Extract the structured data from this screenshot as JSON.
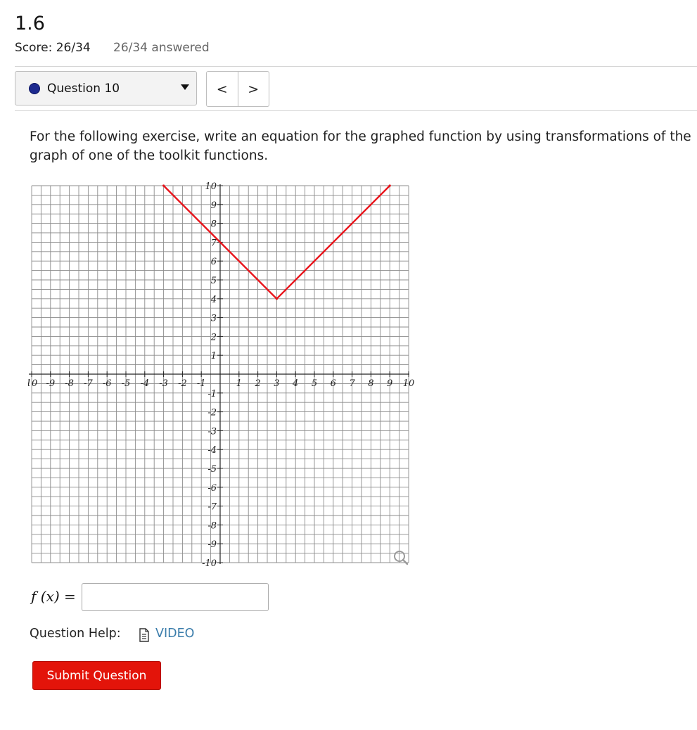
{
  "header": {
    "title": "1.6",
    "score": "Score: 26/34",
    "answered": "26/34 answered"
  },
  "question_nav": {
    "current": "Question 10",
    "prev": "<",
    "next": ">",
    "status_color": "#1d2a8f"
  },
  "prompt": "For the following exercise, write an equation for the graphed function by using transformations of the graph of one of the toolkit functions.",
  "chart_data": {
    "type": "line",
    "xlim": [
      -10,
      10
    ],
    "ylim": [
      -10,
      10
    ],
    "grid": true,
    "grid_step": 0.5,
    "tick_step": 1,
    "x_tick_labels": [
      "10",
      "-9",
      "-8",
      "-7",
      "-6",
      "-5",
      "-4",
      "-3",
      "-2",
      "-1",
      "1",
      "2",
      "3",
      "4",
      "5",
      "6",
      "7",
      "8",
      "9",
      "10"
    ],
    "y_tick_labels": [
      "10",
      "9",
      "8",
      "7",
      "6",
      "5",
      "4",
      "3",
      "2",
      "1",
      "-1",
      "-2",
      "-3",
      "-4",
      "-5",
      "-6",
      "-7",
      "-8",
      "-9",
      "-10"
    ],
    "series": [
      {
        "color": "#e8141b",
        "x": [
          -3,
          3,
          9
        ],
        "y": [
          10,
          4,
          10
        ]
      }
    ]
  },
  "answer": {
    "label": "f (x) =",
    "value": ""
  },
  "help": {
    "label": "Question Help:",
    "video": "VIDEO"
  },
  "submit_label": "Submit Question",
  "colors": {
    "submit_bg": "#e3140a",
    "link": "#3b7dab",
    "grid": "#8c8c8c"
  }
}
